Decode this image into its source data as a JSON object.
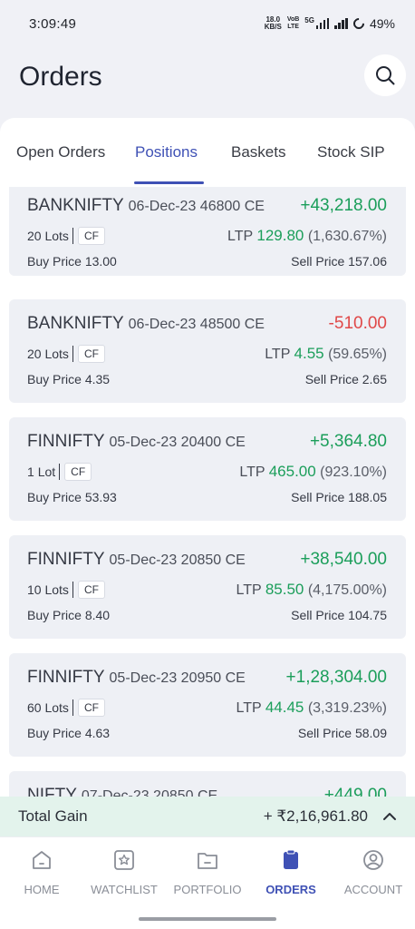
{
  "status_bar": {
    "time": "3:09:49",
    "net_speed_value": "18.0",
    "net_speed_unit": "KB/S",
    "volte_top": "VoB",
    "volte_bottom": "LTE",
    "network": "5G",
    "battery": "49%"
  },
  "header": {
    "title": "Orders"
  },
  "tabs": [
    {
      "label": "Open Orders",
      "active": false
    },
    {
      "label": "Positions",
      "active": true
    },
    {
      "label": "Baskets",
      "active": false
    },
    {
      "label": "Stock SIP",
      "active": false
    }
  ],
  "positions": [
    {
      "symbol": "BANKNIFTY",
      "contract": "06-Dec-23 46800 CE",
      "pnl": "+43,218.00",
      "lots": "20",
      "lots_label": "Lots",
      "cf": "CF",
      "ltp_label": "LTP",
      "ltp": "129.80",
      "change": "(1,630.67%)",
      "buy_label": "Buy Price",
      "buy_price": "13.00",
      "sell_label": "Sell Price",
      "sell_price": "157.06"
    },
    {
      "symbol": "BANKNIFTY",
      "contract": "06-Dec-23 48500 CE",
      "pnl": "-510.00",
      "lots": "20",
      "lots_label": "Lots",
      "cf": "CF",
      "ltp_label": "LTP",
      "ltp": "4.55",
      "change": "(59.65%)",
      "buy_label": "Buy Price",
      "buy_price": "4.35",
      "sell_label": "Sell Price",
      "sell_price": "2.65"
    },
    {
      "symbol": "FINNIFTY",
      "contract": "05-Dec-23 20400 CE",
      "pnl": "+5,364.80",
      "lots": "1",
      "lots_label": "Lot",
      "cf": "CF",
      "ltp_label": "LTP",
      "ltp": "465.00",
      "change": "(923.10%)",
      "buy_label": "Buy Price",
      "buy_price": "53.93",
      "sell_label": "Sell Price",
      "sell_price": "188.05"
    },
    {
      "symbol": "FINNIFTY",
      "contract": "05-Dec-23 20850 CE",
      "pnl": "+38,540.00",
      "lots": "10",
      "lots_label": "Lots",
      "cf": "CF",
      "ltp_label": "LTP",
      "ltp": "85.50",
      "change": "(4,175.00%)",
      "buy_label": "Buy Price",
      "buy_price": "8.40",
      "sell_label": "Sell Price",
      "sell_price": "104.75"
    },
    {
      "symbol": "FINNIFTY",
      "contract": "05-Dec-23 20950 CE",
      "pnl": "+1,28,304.00",
      "lots": "60",
      "lots_label": "Lots",
      "cf": "CF",
      "ltp_label": "LTP",
      "ltp": "44.45",
      "change": "(3,319.23%)",
      "buy_label": "Buy Price",
      "buy_price": "4.63",
      "sell_label": "Sell Price",
      "sell_price": "58.09"
    },
    {
      "symbol": "NIFTY",
      "contract": "07-Dec-23 20850 CE",
      "pnl": "+449.00"
    }
  ],
  "total_gain": {
    "label": "Total Gain",
    "value": "+ ₹2,16,961.80",
    "toggle_icon": "chevron-up-icon"
  },
  "bottom_nav": [
    {
      "label": "HOME",
      "icon": "home-icon",
      "active": false
    },
    {
      "label": "WATCHLIST",
      "icon": "watchlist-icon",
      "active": false
    },
    {
      "label": "PORTFOLIO",
      "icon": "portfolio-icon",
      "active": false
    },
    {
      "label": "ORDERS",
      "icon": "orders-icon",
      "active": true
    },
    {
      "label": "ACCOUNT",
      "icon": "account-icon",
      "active": false
    }
  ],
  "colors": {
    "accent": "#3f51b5",
    "profit": "#1b9e5a",
    "loss": "#e04848",
    "total_gain_bg": "#e3f3ec"
  }
}
